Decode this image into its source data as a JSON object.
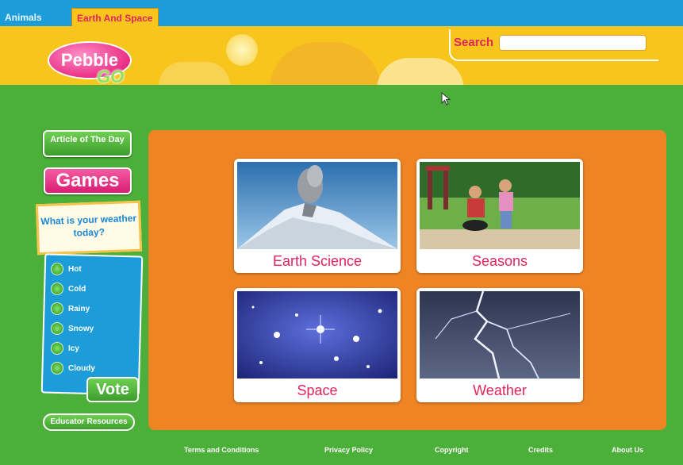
{
  "tabs": [
    {
      "label": "Animals",
      "active": false
    },
    {
      "label": "Earth And Space",
      "active": true
    }
  ],
  "logo": {
    "top": "Pebble",
    "bottom": "GO"
  },
  "search": {
    "label": "Search",
    "value": "",
    "placeholder": ""
  },
  "sidebar": {
    "article_of_the_day": "Article of The Day",
    "games": "Games",
    "poll": {
      "question": "What is your weather today?",
      "options": [
        "Hot",
        "Cold",
        "Rainy",
        "Snowy",
        "Icy",
        "Cloudy"
      ],
      "vote_label": "Vote"
    },
    "educator_resources": "Educator Resources"
  },
  "categories": [
    {
      "label": "Earth Science",
      "image": "volcano-photo"
    },
    {
      "label": "Seasons",
      "image": "children-playground-photo"
    },
    {
      "label": "Space",
      "image": "stars-photo"
    },
    {
      "label": "Weather",
      "image": "lightning-photo"
    }
  ],
  "footer": [
    "Terms and Conditions",
    "Privacy Policy",
    "Copyright",
    "Credits",
    "About Us"
  ],
  "colors": {
    "background": "#4caf3a",
    "topbar": "#1c9dd9",
    "banner": "#f8c51c",
    "panel": "#ee8424",
    "accent_pink": "#e0245e"
  }
}
